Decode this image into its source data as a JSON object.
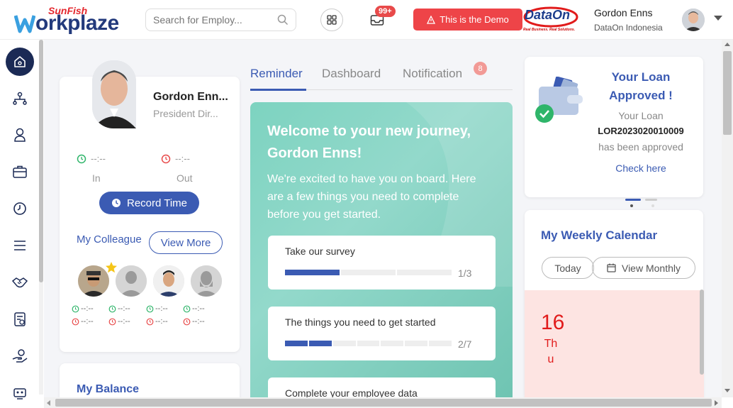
{
  "header": {
    "logo_brand": "SunFish",
    "logo_product": "orkplaze",
    "search_placeholder": "Search for Employ...",
    "notif_count": "99+",
    "demo_label": "This is the Demo",
    "partner_logo": "DataOn",
    "partner_tagline": "Real Business. Real Solutions.",
    "user_name": "Gordon Enns",
    "user_company": "DataOn Indonesia"
  },
  "sidebar": {
    "items": [
      {
        "icon": "home-icon"
      },
      {
        "icon": "org-chart-icon"
      },
      {
        "icon": "person-icon"
      },
      {
        "icon": "briefcase-icon"
      },
      {
        "icon": "clock-icon"
      },
      {
        "icon": "menu-icon"
      },
      {
        "icon": "handshake-icon"
      },
      {
        "icon": "badge-icon"
      },
      {
        "icon": "hand-coin-icon"
      },
      {
        "icon": "robot-icon"
      }
    ]
  },
  "profile": {
    "name": "Gordon Enn...",
    "position": "President Dir...",
    "in_time": "--:--",
    "out_time": "--:--",
    "in_label": "In",
    "out_label": "Out",
    "record_label": "Record Time",
    "colleague_title": "My Colleague",
    "view_more": "View More",
    "colleague_in": "--:--",
    "colleague_out": "--:--"
  },
  "balance": {
    "title": "My Balance"
  },
  "tabs": {
    "reminder": "Reminder",
    "dashboard": "Dashboard",
    "notification": "Notification",
    "notification_count": "8"
  },
  "welcome": {
    "title": "Welcome to your new journey, Gordon Enns!",
    "description": "We're excited to have you on board. Here are a few things you need to complete before you get started.",
    "tasks": [
      {
        "title": "Take our survey",
        "progress": "1/3",
        "done": 1,
        "total": 3
      },
      {
        "title": "The things you need to get started",
        "progress": "2/7",
        "done": 2,
        "total": 7
      },
      {
        "title": "Complete your employee data",
        "progress": "",
        "done": 0,
        "total": 0
      }
    ]
  },
  "loan": {
    "title": "Your Loan Approved !",
    "line1": "Your Loan",
    "code": "LOR2023020010009",
    "line2": "has been approved",
    "link": "Check here"
  },
  "calendar": {
    "title": "My Weekly Calendar",
    "today": "Today",
    "view_monthly": "View Monthly",
    "day_number": "16",
    "day_name": "Thu"
  },
  "colors": {
    "primary": "#3b5bb3",
    "danger": "#ee4448",
    "success": "#2fb56a",
    "teal": "#7dd3c0"
  }
}
